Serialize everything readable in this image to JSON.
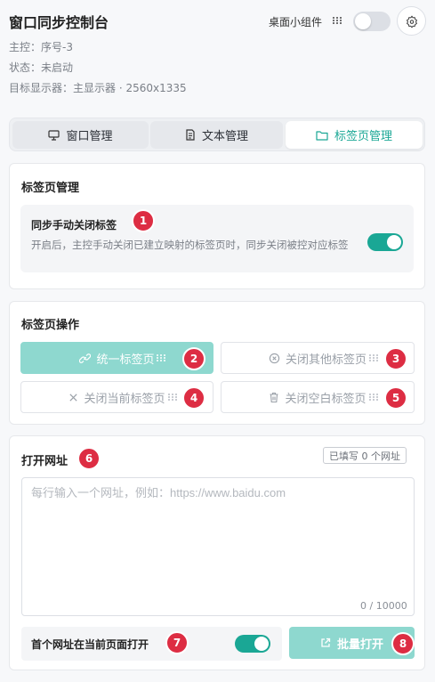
{
  "header": {
    "title": "窗口同步控制台",
    "master": "主控：序号-3",
    "status": "状态：未启动",
    "display": "目标显示器：主显示器 · 2560x1335",
    "widget_label": "桌面小组件",
    "widget_toggle_on": false
  },
  "tabs": [
    {
      "label": "窗口管理",
      "icon": "monitor-icon",
      "active": false
    },
    {
      "label": "文本管理",
      "icon": "document-icon",
      "active": false
    },
    {
      "label": "标签页管理",
      "icon": "folder-icon",
      "active": true
    }
  ],
  "tab_management": {
    "title": "标签页管理",
    "sync_close": {
      "title": "同步手动关闭标签",
      "description": "开启后，主控手动关闭已建立映射的标签页时，同步关闭被控对应标签",
      "enabled": true
    }
  },
  "tab_ops": {
    "title": "标签页操作",
    "buttons": [
      {
        "label": "统一标签页",
        "icon": "link-icon"
      },
      {
        "label": "关闭其他标签页",
        "icon": "circle-x-icon"
      },
      {
        "label": "关闭当前标签页",
        "icon": "x-icon"
      },
      {
        "label": "关闭空白标签页",
        "icon": "trash-icon"
      }
    ]
  },
  "open_urls": {
    "title": "打开网址",
    "count_badge": "已填写 0 个网址",
    "placeholder": "每行输入一个网址，例如：https://www.baidu.com",
    "value": "",
    "char_count": "0 / 10000",
    "first_url_label": "首个网址在当前页面打开",
    "first_url_enabled": true,
    "batch_open_label": "批量打开"
  },
  "annotations": [
    "1",
    "2",
    "3",
    "4",
    "5",
    "6",
    "7",
    "8"
  ],
  "colors": {
    "accent": "#1aa795",
    "accent_light": "#8ed8cf",
    "badge": "#dd2d43"
  }
}
